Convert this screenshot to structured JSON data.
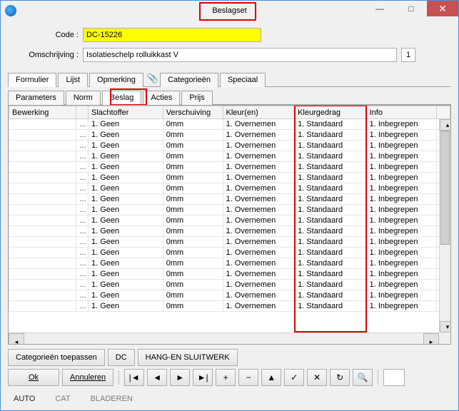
{
  "window": {
    "title": "Beslagset"
  },
  "chrome": {
    "min": "—",
    "max": "□",
    "close": "✕"
  },
  "form": {
    "code_label": "Code :",
    "code_value": "DC-15226",
    "desc_label": "Omschrijving :",
    "desc_value": "Isolatieschelp rolluikkast V",
    "num": "1"
  },
  "tabs": {
    "main": [
      "Formulier",
      "Lijst",
      "Opmerking",
      "Categorieën",
      "Speciaal"
    ],
    "sub": [
      "Parameters",
      "Norm",
      "Beslag",
      "Acties",
      "Prijs"
    ]
  },
  "grid": {
    "headers": [
      "Bewerking",
      "",
      "Slachtoffer",
      "Verschuiving",
      "Kleur(en)",
      "Kleurgedrag",
      "Info",
      ""
    ],
    "ellipsis": "...",
    "row": {
      "slachtoffer": "1. Geen",
      "verschuiving": "0mm",
      "kleuren": "1. Overnemen",
      "kleurgedrag": "1. Standaard",
      "info": "1. Inbegrepen"
    },
    "row_count": 18
  },
  "buttons": {
    "cat": "Categorieën toepassen",
    "dc": "DC",
    "hang": "HANG-EN SLUITWERK",
    "ok": "Ok",
    "cancel": "Annuleren",
    "first": "|◄",
    "prev": "◄",
    "next": "►",
    "last": "►|",
    "plus": "+",
    "minus": "−",
    "up": "▲",
    "check": "✓",
    "x": "✕",
    "refresh": "↻",
    "search": "🔍"
  },
  "status": {
    "auto": "AUTO",
    "cat": "CAT",
    "mode": "BLADEREN"
  }
}
